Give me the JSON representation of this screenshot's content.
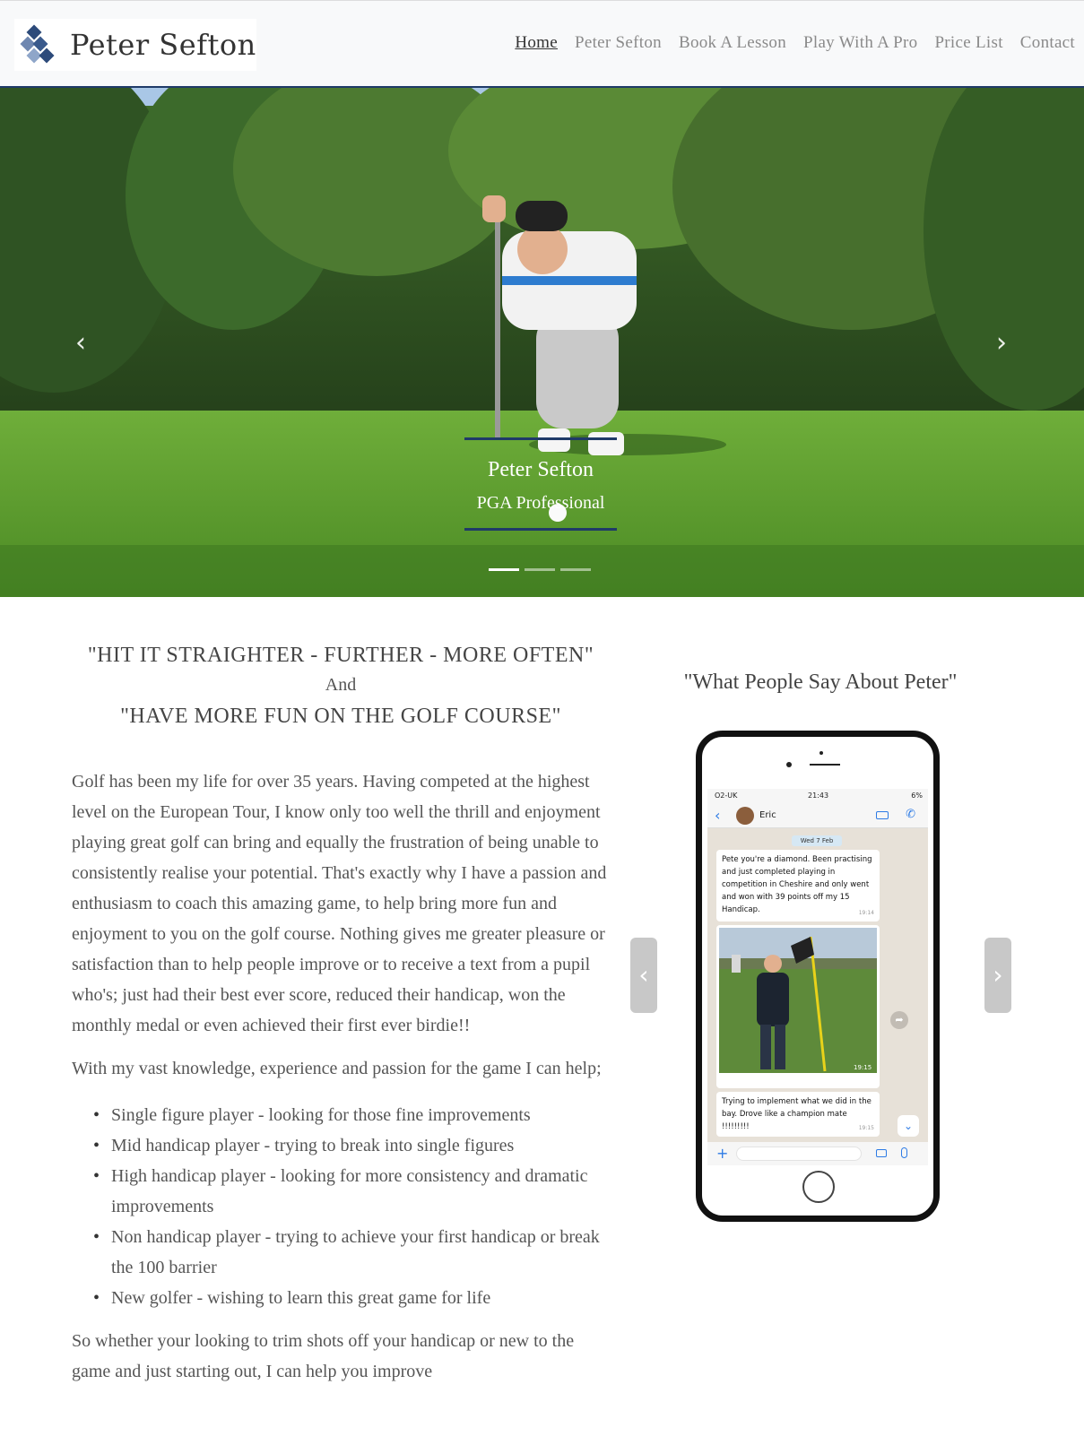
{
  "header": {
    "site_title": "Peter Sefton",
    "nav": [
      {
        "label": "Home",
        "active": true
      },
      {
        "label": "Peter Sefton",
        "active": false
      },
      {
        "label": "Book A Lesson",
        "active": false
      },
      {
        "label": "Play With A Pro",
        "active": false
      },
      {
        "label": "Price List",
        "active": false
      },
      {
        "label": "Contact",
        "active": false
      }
    ]
  },
  "hero": {
    "caption_title": "Peter Sefton",
    "caption_subtitle": "PGA Professional",
    "prev_icon": "chevron-left-icon",
    "next_icon": "chevron-right-icon",
    "slide_count": 3,
    "active_slide": 1
  },
  "main": {
    "headline1": "\"HIT IT STRAIGHTER - FURTHER - MORE OFTEN\"",
    "headline_and": "And",
    "headline2": "\"HAVE MORE FUN ON THE GOLF COURSE\"",
    "paragraph1": "Golf has been my life for over 35 years. Having competed at the highest level on the European Tour, I know only too well the thrill and enjoyment playing great golf can bring and equally the frustration of being unable to consistently realise your potential. That's exactly why I have a passion and enthusiasm to coach this amazing game, to help bring more fun and enjoyment to you on the golf course. Nothing gives me greater pleasure or satisfaction than to help people improve or to receive a text from a pupil who's; just had their best ever score, reduced their handicap, won the monthly medal or even achieved their first ever birdie!!",
    "paragraph2": "With my vast knowledge, experience and passion for the game I can help;",
    "help_list": [
      "Single figure player - looking for those fine improvements",
      "Mid handicap player - trying to break into single figures",
      "High handicap player - looking for more consistency and dramatic improvements",
      "Non handicap player - trying to achieve your first handicap or break the 100 barrier",
      "New golfer - wishing to learn this great game for life"
    ],
    "paragraph3": "So whether your looking to trim shots off your handicap or new to the game and just starting out, I can help you improve"
  },
  "testimonials": {
    "title": "\"What People Say About Peter\"",
    "phone": {
      "carrier": "O2-UK",
      "time": "21:43",
      "battery": "6%",
      "contact": "Eric",
      "date_chip": "Wed 7 Feb",
      "message1": "Pete you're a diamond. Been practising and just completed playing in competition in Cheshire and only went and won with 39 points off my 15 Handicap.",
      "message1_time": "19:14",
      "photo_time": "19:15",
      "message2": "Trying to implement what we did in the bay. Drove like a champion mate !!!!!!!!!",
      "message2_time": "19:15"
    }
  },
  "colors": {
    "accent": "#1f3a68",
    "header_bg": "#f8f9fa",
    "nav_text": "#8a8a8a",
    "whatsapp_blue": "#2d7be5"
  }
}
